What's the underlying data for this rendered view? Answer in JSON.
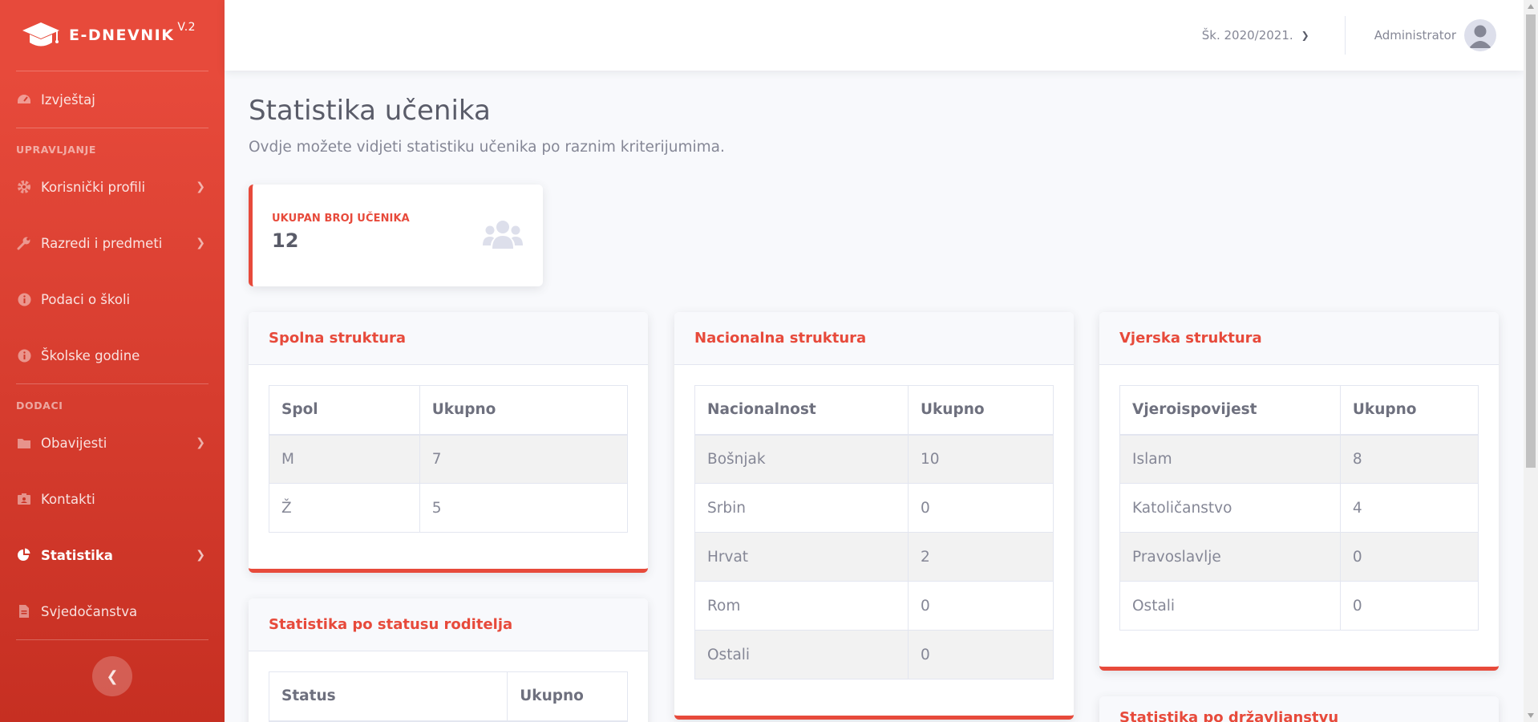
{
  "brand": {
    "name": "E-DNEVNIK",
    "version": "V.2"
  },
  "sidebar": {
    "items_top": [
      {
        "label": "Izvještaj",
        "icon": "dashboard-icon"
      }
    ],
    "section_management": "UPRAVLJANJE",
    "items_management": [
      {
        "label": "Korisnički profili",
        "icon": "cog-icon"
      },
      {
        "label": "Razredi i predmeti",
        "icon": "wrench-icon"
      },
      {
        "label": "Podaci o školi",
        "icon": "info-icon"
      },
      {
        "label": "Školske godine",
        "icon": "info-icon"
      }
    ],
    "section_addons": "DODACI",
    "items_addons": [
      {
        "label": "Obavijesti",
        "icon": "folder-icon"
      },
      {
        "label": "Kontakti",
        "icon": "contact-icon"
      },
      {
        "label": "Statistika",
        "icon": "pie-chart-icon"
      },
      {
        "label": "Svjedočanstva",
        "icon": "file-icon"
      }
    ]
  },
  "topbar": {
    "school_year": "Šk. 2020/2021.",
    "user_name": "Administrator"
  },
  "page": {
    "title": "Statistika učenika",
    "subtitle": "Ovdje možete vidjeti statistiku učenika po raznim kriterijumima."
  },
  "stat_card": {
    "label": "UKUPAN BROJ UČENIKA",
    "value": "12"
  },
  "cards": {
    "gender": {
      "title": "Spolna struktura",
      "headers": [
        "Spol",
        "Ukupno"
      ],
      "rows": [
        [
          "M",
          "7"
        ],
        [
          "Ž",
          "5"
        ]
      ]
    },
    "nationality": {
      "title": "Nacionalna struktura",
      "headers": [
        "Nacionalnost",
        "Ukupno"
      ],
      "rows": [
        [
          "Bošnjak",
          "10"
        ],
        [
          "Srbin",
          "0"
        ],
        [
          "Hrvat",
          "2"
        ],
        [
          "Rom",
          "0"
        ],
        [
          "Ostali",
          "0"
        ]
      ]
    },
    "religion": {
      "title": "Vjerska struktura",
      "headers": [
        "Vjeroispovijest",
        "Ukupno"
      ],
      "rows": [
        [
          "Islam",
          "8"
        ],
        [
          "Katoličanstvo",
          "4"
        ],
        [
          "Pravoslavlje",
          "0"
        ],
        [
          "Ostali",
          "0"
        ]
      ]
    },
    "parents": {
      "title": "Statistika po statusu roditelja",
      "headers": [
        "Status",
        "Ukupno"
      ]
    },
    "citizenship": {
      "title": "Statistika po državljanstvu"
    }
  },
  "colors": {
    "accent": "#e74a3b",
    "sidebar_dark": "#c62f22",
    "text": "#5a5c69",
    "muted": "#858796"
  }
}
